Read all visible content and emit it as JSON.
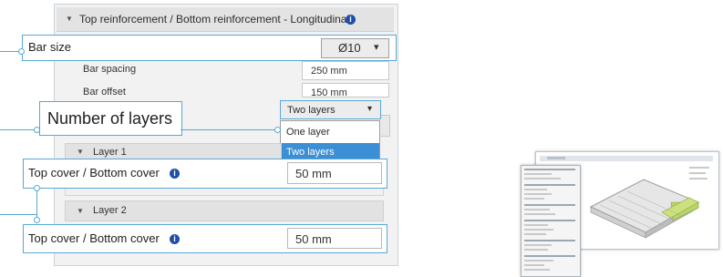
{
  "section": {
    "title": "Top reinforcement / Bottom reinforcement - Longitudinal",
    "info_icon": "i"
  },
  "bar_size": {
    "label": "Bar size",
    "value": "Ø10",
    "chevron": "▾"
  },
  "bar_spacing": {
    "label": "Bar spacing",
    "value": "250 mm"
  },
  "bar_offset": {
    "label": "Bar offset",
    "value": "150 mm"
  },
  "number_of_layers": {
    "label": "Number of layers",
    "value": "Two layers",
    "chevron": "▾",
    "options": [
      "One layer",
      "Two layers"
    ],
    "selected_index": 1
  },
  "layers": [
    {
      "title": "Layer 1",
      "cover_label": "Top cover / Bottom cover",
      "cover_value": "50 mm"
    },
    {
      "title": "Layer 2",
      "cover_label": "Top cover / Bottom cover",
      "cover_value": "50 mm"
    }
  ],
  "expand_icon": "▼",
  "colors": {
    "callout_border": "#58a8d6",
    "selected_option": "#3c8fd5",
    "info_icon": "#1f4fa8"
  }
}
